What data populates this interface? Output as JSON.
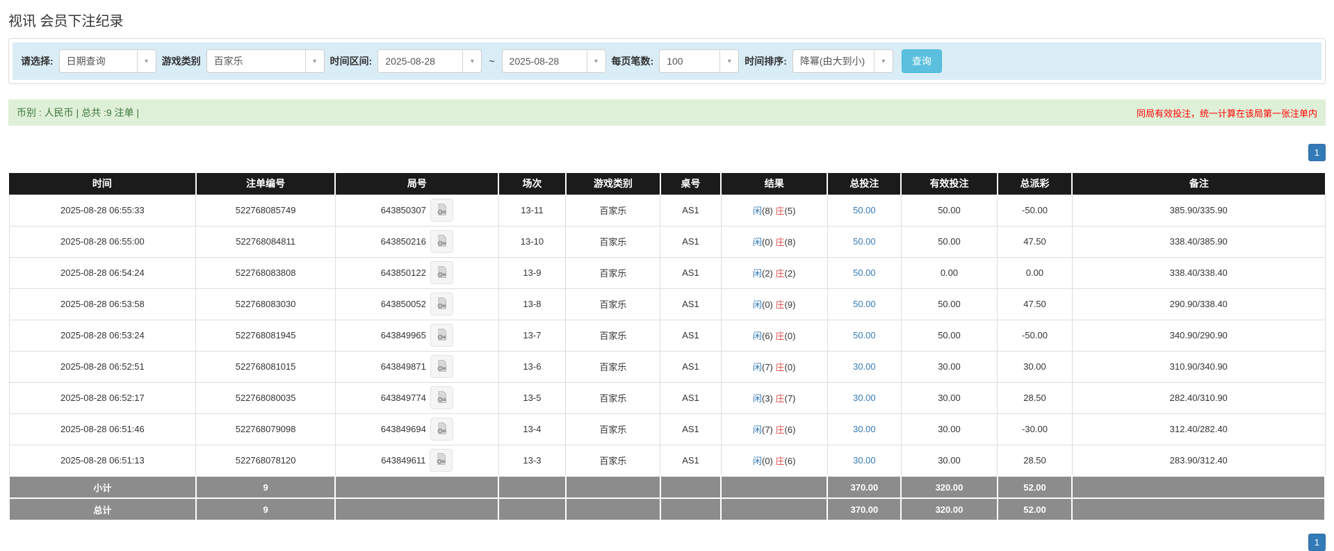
{
  "page": {
    "title": "视讯 会员下注纪录"
  },
  "filters": {
    "query_type": {
      "label": "请选择:",
      "value": "日期查询"
    },
    "game_category": {
      "label": "游戏类别",
      "value": "百家乐"
    },
    "date_range": {
      "label": "时间区间:",
      "from": "2025-08-28",
      "separator": "~",
      "to": "2025-08-28"
    },
    "page_size": {
      "label": "每页笔数:",
      "value": "100"
    },
    "time_sort": {
      "label": "时间排序:",
      "value": "降幂(由大到小)"
    },
    "search_button": "查询"
  },
  "summary": {
    "left": "币别 : 人民币 | 总共 :9 注单 |",
    "right": "同局有效投注，统一计算在该局第一张注单内"
  },
  "pagination": {
    "page": "1"
  },
  "table": {
    "columns": [
      "时间",
      "注单编号",
      "局号",
      "场次",
      "游戏类别",
      "桌号",
      "结果",
      "总投注",
      "有效投注",
      "总派彩",
      "备注"
    ],
    "result_labels": {
      "player": "闲",
      "banker": "庄"
    },
    "rows": [
      {
        "time": "2025-08-28 06:55:33",
        "bet_id": "522768085749",
        "round_id": "643850307",
        "session": "13-11",
        "game": "百家乐",
        "table_no": "AS1",
        "result": {
          "player": 8,
          "banker": 5
        },
        "total_bet": "50.00",
        "valid_bet": "50.00",
        "payout": "-50.00",
        "remark": "385.90/335.90"
      },
      {
        "time": "2025-08-28 06:55:00",
        "bet_id": "522768084811",
        "round_id": "643850216",
        "session": "13-10",
        "game": "百家乐",
        "table_no": "AS1",
        "result": {
          "player": 0,
          "banker": 8
        },
        "total_bet": "50.00",
        "valid_bet": "50.00",
        "payout": "47.50",
        "remark": "338.40/385.90"
      },
      {
        "time": "2025-08-28 06:54:24",
        "bet_id": "522768083808",
        "round_id": "643850122",
        "session": "13-9",
        "game": "百家乐",
        "table_no": "AS1",
        "result": {
          "player": 2,
          "banker": 2
        },
        "total_bet": "50.00",
        "valid_bet": "0.00",
        "payout": "0.00",
        "remark": "338.40/338.40"
      },
      {
        "time": "2025-08-28 06:53:58",
        "bet_id": "522768083030",
        "round_id": "643850052",
        "session": "13-8",
        "game": "百家乐",
        "table_no": "AS1",
        "result": {
          "player": 0,
          "banker": 9
        },
        "total_bet": "50.00",
        "valid_bet": "50.00",
        "payout": "47.50",
        "remark": "290.90/338.40"
      },
      {
        "time": "2025-08-28 06:53:24",
        "bet_id": "522768081945",
        "round_id": "643849965",
        "session": "13-7",
        "game": "百家乐",
        "table_no": "AS1",
        "result": {
          "player": 6,
          "banker": 0
        },
        "total_bet": "50.00",
        "valid_bet": "50.00",
        "payout": "-50.00",
        "remark": "340.90/290.90"
      },
      {
        "time": "2025-08-28 06:52:51",
        "bet_id": "522768081015",
        "round_id": "643849871",
        "session": "13-6",
        "game": "百家乐",
        "table_no": "AS1",
        "result": {
          "player": 7,
          "banker": 0
        },
        "total_bet": "30.00",
        "valid_bet": "30.00",
        "payout": "30.00",
        "remark": "310.90/340.90"
      },
      {
        "time": "2025-08-28 06:52:17",
        "bet_id": "522768080035",
        "round_id": "643849774",
        "session": "13-5",
        "game": "百家乐",
        "table_no": "AS1",
        "result": {
          "player": 3,
          "banker": 7
        },
        "total_bet": "30.00",
        "valid_bet": "30.00",
        "payout": "28.50",
        "remark": "282.40/310.90"
      },
      {
        "time": "2025-08-28 06:51:46",
        "bet_id": "522768079098",
        "round_id": "643849694",
        "session": "13-4",
        "game": "百家乐",
        "table_no": "AS1",
        "result": {
          "player": 7,
          "banker": 6
        },
        "total_bet": "30.00",
        "valid_bet": "30.00",
        "payout": "-30.00",
        "remark": "312.40/282.40"
      },
      {
        "time": "2025-08-28 06:51:13",
        "bet_id": "522768078120",
        "round_id": "643849611",
        "session": "13-3",
        "game": "百家乐",
        "table_no": "AS1",
        "result": {
          "player": 0,
          "banker": 6
        },
        "total_bet": "30.00",
        "valid_bet": "30.00",
        "payout": "28.50",
        "remark": "283.90/312.40"
      }
    ],
    "subtotal": {
      "label": "小计",
      "count": "9",
      "total_bet": "370.00",
      "valid_bet": "320.00",
      "payout": "52.00"
    },
    "total": {
      "label": "总计",
      "count": "9",
      "total_bet": "370.00",
      "valid_bet": "320.00",
      "payout": "52.00"
    }
  },
  "colors": {
    "accent_blue": "#337ab7",
    "button_info": "#5bc0de",
    "panel_blue": "#d9edf7",
    "bar_green": "#dff0d8",
    "text_green": "#3c763d",
    "notice_red": "#ff0000",
    "header_black": "#1b1b1b",
    "footer_gray": "#8c8c8c",
    "player_blue": "#337ab7",
    "banker_red": "#d9534f"
  }
}
